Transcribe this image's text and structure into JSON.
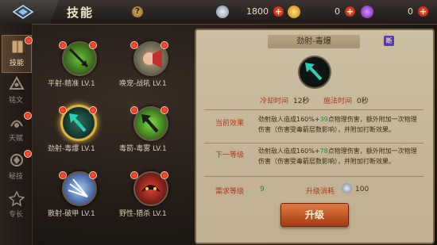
{
  "header": {
    "title": "技能",
    "help_label": "?"
  },
  "currencies": [
    {
      "icon": "silver-coin-icon",
      "value": "1800",
      "plus": "+"
    },
    {
      "icon": "gold-coin-icon",
      "value": "0",
      "plus": "+"
    },
    {
      "icon": "purple-gem-icon",
      "value": "0",
      "plus": "+"
    }
  ],
  "nav": [
    {
      "label": "技能",
      "icon": "book-icon"
    },
    {
      "label": "铭文",
      "icon": "rune-icon"
    },
    {
      "label": "天赋",
      "icon": "talent-icon"
    },
    {
      "label": "秘技",
      "icon": "secret-skill-icon"
    },
    {
      "label": "专长",
      "icon": "specialty-icon"
    }
  ],
  "skills": [
    {
      "name": "平射-精准",
      "level": "LV.1",
      "icon": "precise-shot-icon"
    },
    {
      "name": "唤宠-战吼",
      "level": "LV.1",
      "icon": "pet-warcry-icon"
    },
    {
      "name": "劲射-毒爆",
      "level": "LV.1",
      "icon": "poison-burst-icon"
    },
    {
      "name": "毒箭-毒雾",
      "level": "LV.1",
      "icon": "poison-mist-icon"
    },
    {
      "name": "散射-破甲",
      "level": "LV.1",
      "icon": "scatter-shot-icon"
    },
    {
      "name": "野性-猎杀",
      "level": "LV.1",
      "icon": "wild-hunt-icon"
    }
  ],
  "detail": {
    "title": "劲射-毒爆",
    "tag": "断",
    "cooldown_label": "冷却时间",
    "cooldown_value": "12秒",
    "cast_label": "施法时间",
    "cast_value": "0秒",
    "current_label": "当前效果",
    "current_pre": "劲射敌人造成160%+",
    "current_hl": "39",
    "current_post": "点物理伤害，额外附加一次物理伤害（伤害受毒箭层数影响），并附加打断效果。",
    "next_label": "下一等级",
    "next_pre": "劲射敌人造成160%+",
    "next_hl": "78",
    "next_post": "点物理伤害，额外附加一次物理伤害（伤害受毒箭层数影响），并附加打断效果。",
    "req_label": "需求等级",
    "req_value": "9",
    "cost_label": "升级消耗",
    "cost_value": "100",
    "upgrade_label": "升级"
  },
  "colors": {
    "highlight": "#2a8a2a",
    "accent_red": "#b03a1c",
    "gold_ring": "#e0b040"
  }
}
